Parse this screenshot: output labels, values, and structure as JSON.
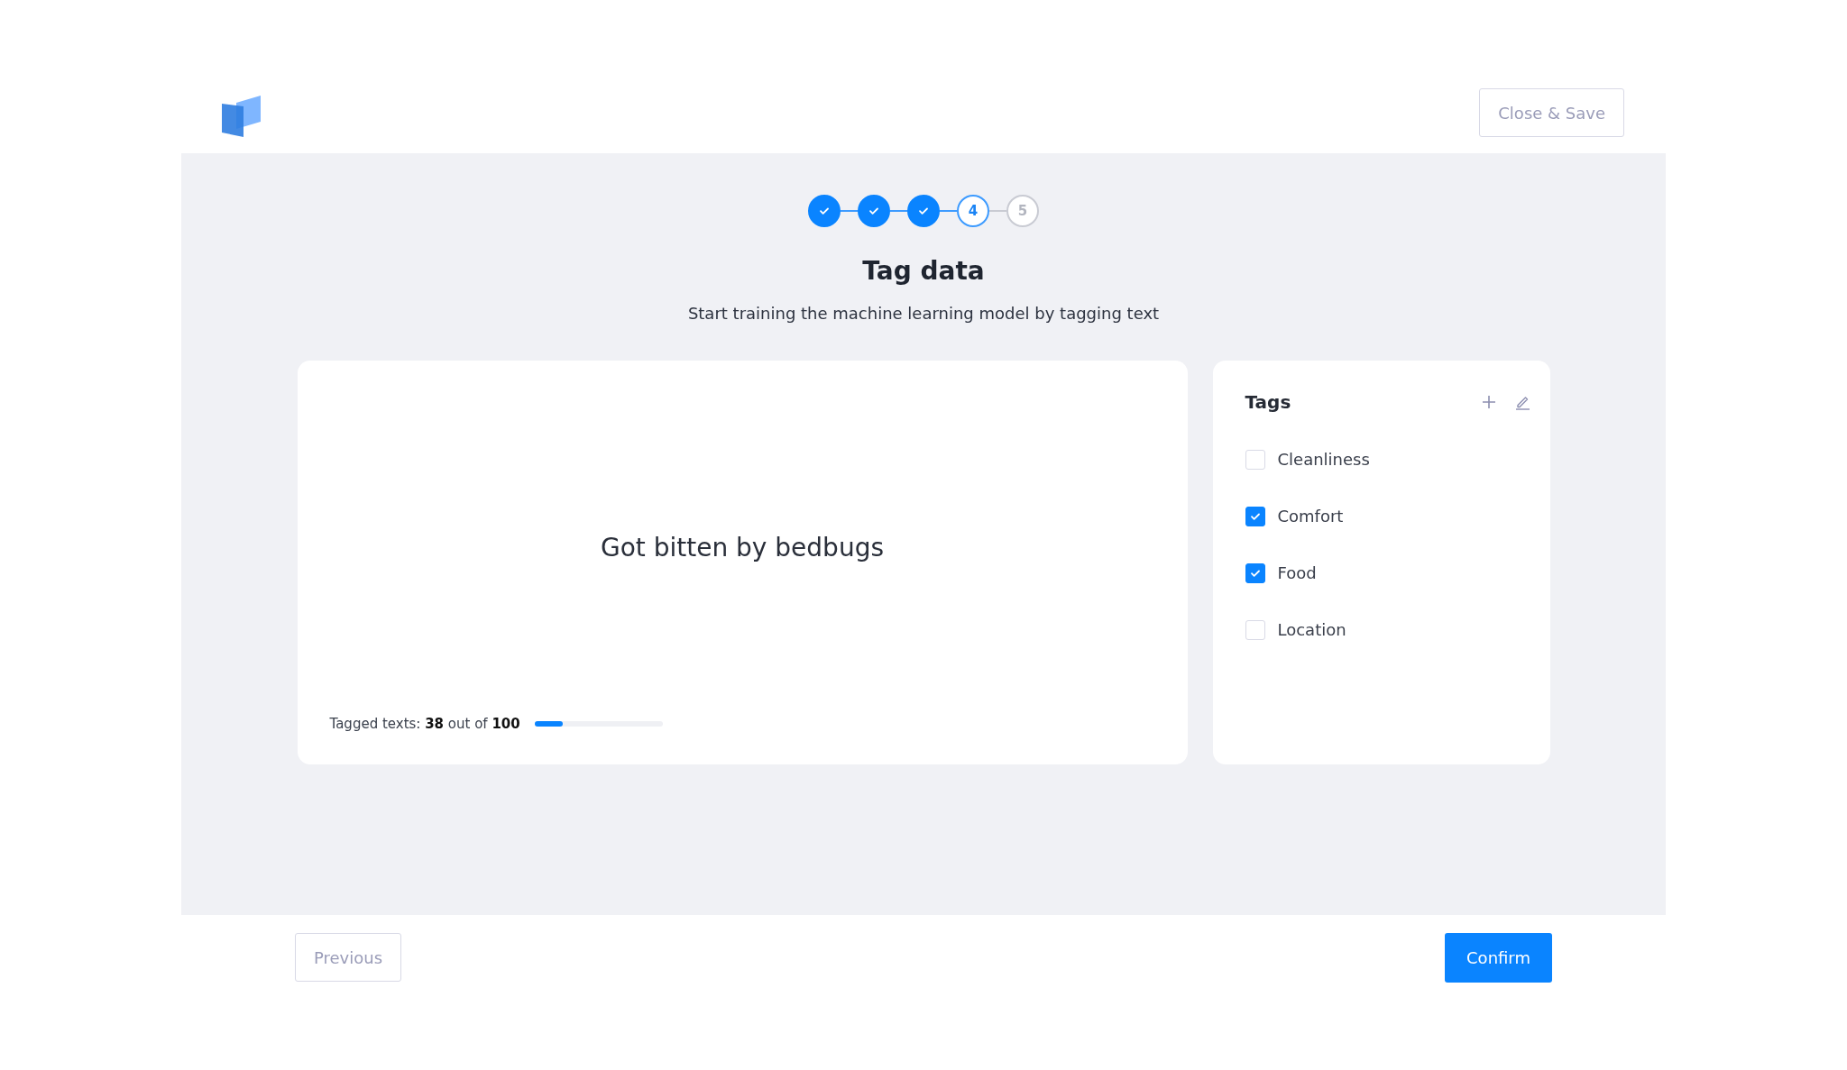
{
  "header": {
    "close_button": "Close & Save"
  },
  "steps": [
    {
      "done": true,
      "selected": false
    },
    {
      "done": true,
      "selected": false
    },
    {
      "done": true,
      "selected": false
    },
    {
      "label": "4",
      "done": false,
      "selected": true
    },
    {
      "label": "5",
      "done": false,
      "selected": false
    }
  ],
  "title": "Tag data",
  "subtitle": "Start training the machine learning model by tagging text",
  "sample": {
    "text": "Got bitten by bedbugs",
    "progress_text": "Tagged texts: **38** out of **100**",
    "level": 0.22
  },
  "tags_panel": {
    "title": "Tags",
    "tags": [
      {
        "label": "Cleanliness",
        "checked": false
      },
      {
        "label": "Comfort",
        "checked": true
      },
      {
        "label": "Food",
        "checked": true
      },
      {
        "label": "Location",
        "checked": false
      }
    ]
  },
  "footer": {
    "previous": "Previous",
    "confirm": "Confirm"
  }
}
